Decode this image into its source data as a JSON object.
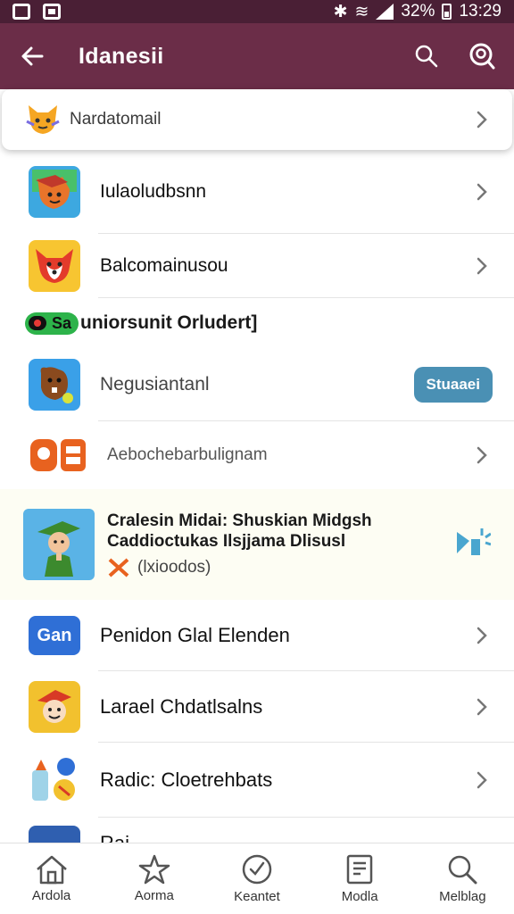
{
  "status_bar": {
    "battery": "32%",
    "time": "13:29"
  },
  "app_bar": {
    "title": "Idanesii"
  },
  "pinned": {
    "label": "Nardatomail"
  },
  "rows_top": [
    {
      "label": "Iulaoludbsnn",
      "icon": "fox-icon"
    },
    {
      "label": "Balcomainusou",
      "icon": "red-fox-icon"
    }
  ],
  "section": {
    "pill": "Sa",
    "title": "uniorsunit Orludert]"
  },
  "row_button": {
    "label": "Negusiantanl",
    "button": "Stuaaei",
    "icon": "beaver-icon"
  },
  "row_plain": {
    "label": "Aebochebarbulignam",
    "icon": "orange-blocks-icon"
  },
  "featured": {
    "title_line1": "Cralesin Midai: Shuskian Midgsh",
    "title_line2": "Caddioctukas Ilsjjama Dlisusl",
    "sub": "(lxioodos)",
    "icon": "robin-hood-icon"
  },
  "rows_bottom": [
    {
      "label": "Penidon Glal Elenden",
      "icon_text": "Gan"
    },
    {
      "label": "Larael Chdatlsalns",
      "icon": "hat-character-icon"
    },
    {
      "label": "Radic: Cloetrehbats",
      "icon": "spray-icon"
    }
  ],
  "partial_row": {
    "label": "Rai"
  },
  "bottom_nav": [
    {
      "label": "Ardola",
      "icon": "home-icon"
    },
    {
      "label": "Aorma",
      "icon": "star-icon"
    },
    {
      "label": "Keantet",
      "icon": "clock-icon"
    },
    {
      "label": "Modla",
      "icon": "document-icon"
    },
    {
      "label": "Melblag",
      "icon": "search-icon"
    }
  ],
  "colors": {
    "status_bar": "#4a1f35",
    "app_bar": "#6b2d48",
    "accent_button": "#4a90b4",
    "pill": "#2db34a"
  }
}
